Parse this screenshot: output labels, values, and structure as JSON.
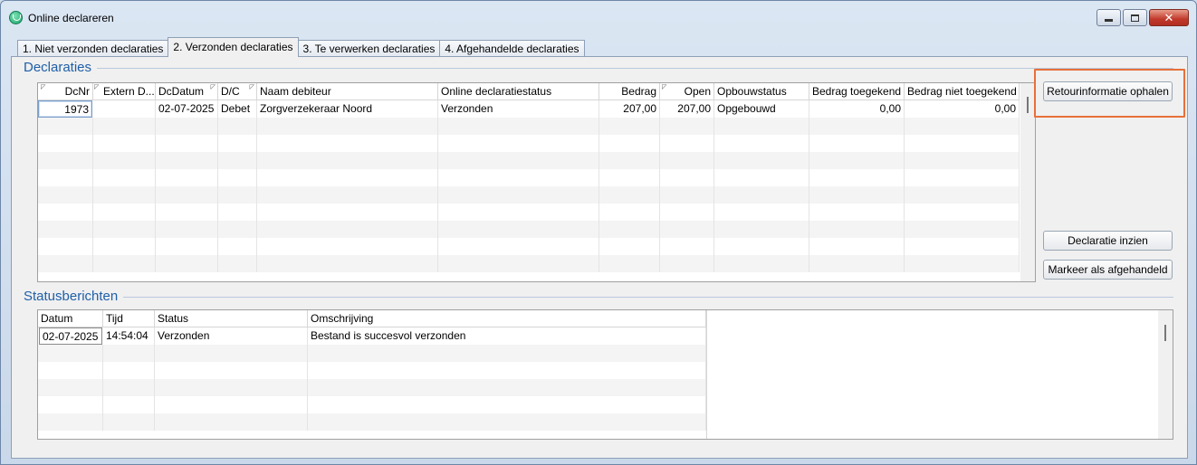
{
  "window": {
    "title": "Online declareren",
    "close_glyph": "✕"
  },
  "tabs": [
    {
      "label": "1. Niet verzonden declaraties",
      "active": false
    },
    {
      "label": "2. Verzonden declaraties",
      "active": true
    },
    {
      "label": "3. Te verwerken declaraties",
      "active": false
    },
    {
      "label": "4. Afgehandelde declaraties",
      "active": false
    }
  ],
  "declaraties": {
    "title": "Declaraties",
    "columns": {
      "dcnr": "DcNr",
      "extern": "Extern D...",
      "dcdatum": "DcDatum",
      "dc": "D/C",
      "naam": "Naam debiteur",
      "status": "Online declaratiestatus",
      "bedrag": "Bedrag",
      "open": "Open",
      "opbouw": "Opbouwstatus",
      "toegekend": "Bedrag toegekend",
      "niet_toegekend": "Bedrag niet toegekend"
    },
    "rows": [
      {
        "dcnr": "1973",
        "extern": "",
        "dcdatum": "02-07-2025",
        "dc": "Debet",
        "naam": "Zorgverzekeraar Noord",
        "status": "Verzonden",
        "bedrag": "207,00",
        "open": "207,00",
        "opbouw": "Opgebouwd",
        "toegekend": "0,00",
        "niet_toegekend": "0,00"
      }
    ]
  },
  "actions": {
    "retour": "Retourinformatie ophalen",
    "inzien": "Declaratie inzien",
    "markeer": "Markeer als afgehandeld"
  },
  "statusberichten": {
    "title": "Statusberichten",
    "columns": {
      "datum": "Datum",
      "tijd": "Tijd",
      "status": "Status",
      "omschrijving": "Omschrijving"
    },
    "rows": [
      {
        "datum": "02-07-2025",
        "tijd": "14:54:04",
        "status": "Verzonden",
        "omschrijving": "Bestand is succesvol verzonden"
      }
    ]
  },
  "colors": {
    "accent": "#1f5fa8",
    "highlight": "#e8703a"
  }
}
